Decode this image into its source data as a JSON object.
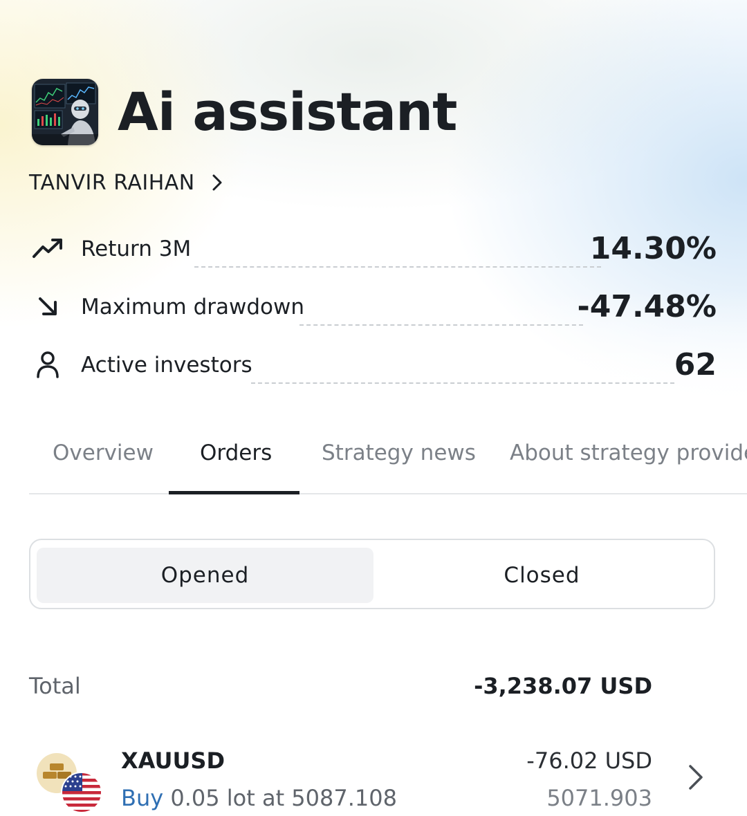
{
  "strategy": {
    "title": "Ai assistant",
    "provider_name": "TANVIR RAIHAN",
    "avatar_icon": "ai-robot-trading-icon"
  },
  "stats": [
    {
      "icon": "trend-up-icon",
      "label": "Return 3M",
      "value": "14.30%"
    },
    {
      "icon": "arrow-down-right-icon",
      "label": "Maximum drawdown",
      "value": "-47.48%"
    },
    {
      "icon": "person-icon",
      "label": "Active investors",
      "value": "62"
    }
  ],
  "tabs": [
    {
      "label": "Overview",
      "active": false
    },
    {
      "label": "Orders",
      "active": true
    },
    {
      "label": "Strategy news",
      "active": false
    },
    {
      "label": "About strategy provider",
      "active": false
    }
  ],
  "segmented": {
    "options": [
      "Opened",
      "Closed"
    ],
    "selected": "Opened"
  },
  "totals": {
    "label": "Total",
    "value": "-3,238.07 USD"
  },
  "orders": [
    {
      "symbol": "XAUUSD",
      "side": "Buy",
      "detail": "0.05 lot at 5087.108",
      "pl": "-76.02 USD",
      "current_price": "5071.903",
      "icons": [
        "gold-bars-icon",
        "us-flag-icon"
      ]
    }
  ],
  "colors": {
    "accent_text": "#1b1f24",
    "buy": "#2f6fb3",
    "muted": "#7b8087",
    "gradient_left": "#faf3cd",
    "gradient_right": "#cbe2f6"
  }
}
